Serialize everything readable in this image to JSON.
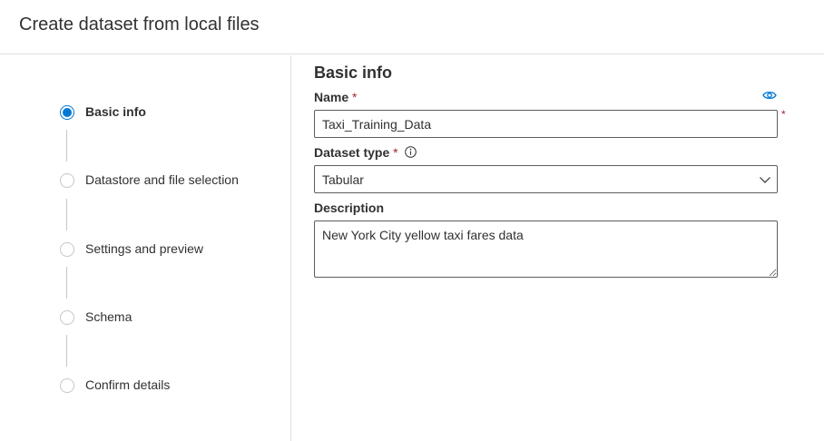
{
  "header": {
    "title": "Create dataset from local files"
  },
  "steps": [
    {
      "label": "Basic info",
      "active": true
    },
    {
      "label": "Datastore and file selection",
      "active": false
    },
    {
      "label": "Settings and preview",
      "active": false
    },
    {
      "label": "Schema",
      "active": false
    },
    {
      "label": "Confirm details",
      "active": false
    }
  ],
  "form": {
    "section_title": "Basic info",
    "name": {
      "label": "Name",
      "required_marker": "*",
      "value": "Taxi_Training_Data"
    },
    "dataset_type": {
      "label": "Dataset type",
      "required_marker": "*",
      "selected": "Tabular"
    },
    "description": {
      "label": "Description",
      "value": "New York City yellow taxi fares data"
    }
  },
  "icons": {
    "eye": "eye-icon",
    "info": "info-icon",
    "chevron": "chevron-down-icon"
  },
  "colors": {
    "accent": "#0078d4",
    "required": "#a4262c",
    "border": "#605e5c",
    "divider": "#e1dfdd"
  }
}
